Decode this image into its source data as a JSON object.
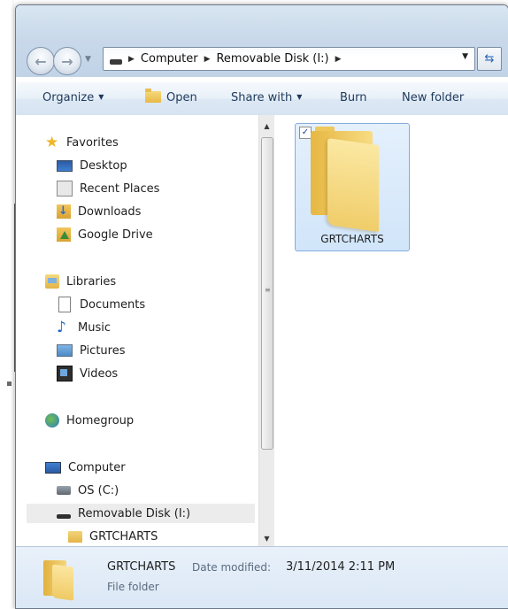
{
  "address": {
    "crumbs": [
      "Computer",
      "Removable Disk (I:)"
    ]
  },
  "toolbar": {
    "organize": "Organize",
    "open": "Open",
    "share_with": "Share with",
    "burn": "Burn",
    "new_folder": "New folder"
  },
  "nav": {
    "favorites": {
      "label": "Favorites",
      "items": [
        "Desktop",
        "Recent Places",
        "Downloads",
        "Google Drive"
      ]
    },
    "libraries": {
      "label": "Libraries",
      "items": [
        "Documents",
        "Music",
        "Pictures",
        "Videos"
      ]
    },
    "homegroup": "Homegroup",
    "computer": {
      "label": "Computer",
      "items": [
        "OS (C:)",
        "Removable Disk (I:)"
      ],
      "subfolder": "GRTCHARTS"
    }
  },
  "content": {
    "items": [
      {
        "name": "GRTCHARTS",
        "selected": true,
        "checked": true
      }
    ]
  },
  "details": {
    "name": "GRTCHARTS",
    "modified_label": "Date modified:",
    "modified_value": "3/11/2014 2:11 PM",
    "type": "File folder"
  },
  "icons": {
    "favorites": "star-icon",
    "desktop": "desktop-icon",
    "recent_places": "recent-places-icon",
    "downloads": "downloads-icon",
    "google_drive": "google-drive-icon",
    "libraries": "libraries-icon",
    "documents": "document-icon",
    "music": "music-icon",
    "pictures": "pictures-icon",
    "videos": "videos-icon",
    "homegroup": "homegroup-icon",
    "computer": "computer-icon",
    "os_drive": "hard-drive-icon",
    "removable": "removable-disk-icon",
    "folder": "folder-icon"
  },
  "colors": {
    "frame": "#c9d9ea",
    "selection": "#d1e5fa",
    "selection_border": "#84acdd",
    "link_text": "#1e395b"
  }
}
